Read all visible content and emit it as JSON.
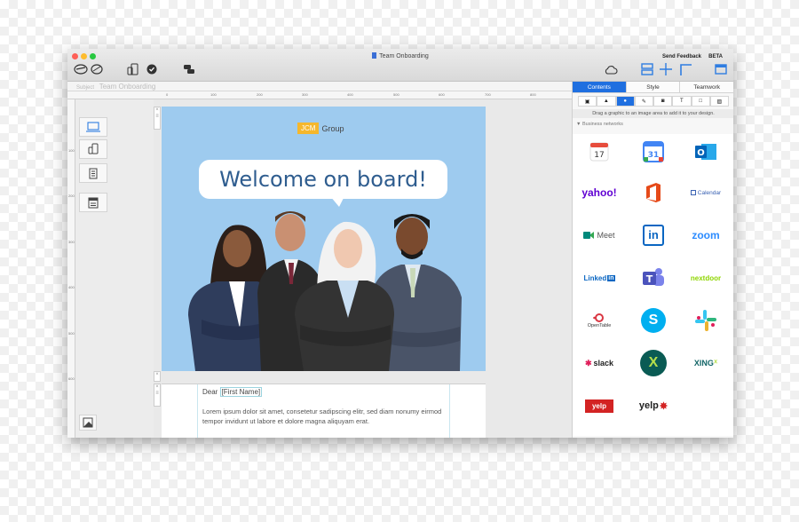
{
  "window": {
    "title": "Team Onboarding",
    "send_feedback": "Send Feedback",
    "beta": "BETA"
  },
  "subject": {
    "label": "Subject",
    "value": "Team Onboarding"
  },
  "ruler": {
    "top_labels": [
      "0",
      "100",
      "200",
      "300",
      "400",
      "500",
      "600",
      "700",
      "800"
    ],
    "left_labels": [
      "100",
      "200",
      "300",
      "400",
      "500",
      "600"
    ]
  },
  "email": {
    "brand_badge": "JCM",
    "brand_name": "Group",
    "headline": "Welcome on board!",
    "greeting": "Dear",
    "placeholder": "[First Name]",
    "body": "Lorem ipsum dolor sit amet, consetetur sadipscing elitr, sed diam nonumy eirmod tempor invidunt ut labore et dolore magna aliquyam erat."
  },
  "panel": {
    "tabs": [
      "Contents",
      "Style",
      "Teamwork"
    ],
    "active_tab": "Contents",
    "hint": "Drag a graphic to an image area to add it to your design.",
    "section": "Business networks",
    "logos": [
      {
        "name": "ical-icon",
        "text": "17"
      },
      {
        "name": "google-calendar-icon",
        "text": "31"
      },
      {
        "name": "outlook-icon",
        "text": "O"
      },
      {
        "name": "yahoo-icon",
        "text": "yahoo!"
      },
      {
        "name": "office-icon",
        "text": ""
      },
      {
        "name": "calendar-icon",
        "text": "Calendar"
      },
      {
        "name": "google-meet-icon",
        "text": "Meet"
      },
      {
        "name": "linkedin-icon",
        "text": "in"
      },
      {
        "name": "zoom-icon",
        "text": "zoom"
      },
      {
        "name": "linkedin-wordmark-icon",
        "text": "Linked"
      },
      {
        "name": "teams-icon",
        "text": "T"
      },
      {
        "name": "nextdoor-icon",
        "text": "nextdoor"
      },
      {
        "name": "opentable-icon",
        "text": "OpenTable"
      },
      {
        "name": "skype-icon",
        "text": "S"
      },
      {
        "name": "slack-icon",
        "text": ""
      },
      {
        "name": "slack-wordmark-icon",
        "text": "slack"
      },
      {
        "name": "xing-icon",
        "text": "X"
      },
      {
        "name": "xing-wordmark-icon",
        "text": "XING"
      },
      {
        "name": "yelp-badge-icon",
        "text": "yelp"
      },
      {
        "name": "yelp-icon",
        "text": "yelp"
      }
    ]
  },
  "colors": {
    "accent": "#1f6fe0",
    "banner": "#9ecbef",
    "headline": "#2f5d8f"
  }
}
